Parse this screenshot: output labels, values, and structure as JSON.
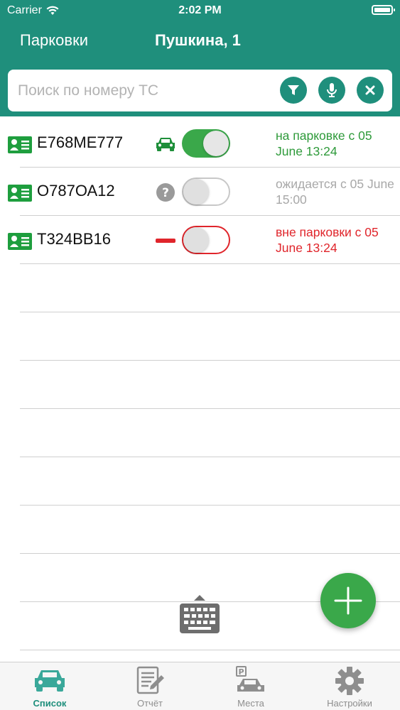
{
  "status_bar": {
    "carrier": "Carrier",
    "time": "2:02 PM"
  },
  "nav": {
    "back_label": "Парковки",
    "title": "Пушкина, 1"
  },
  "search": {
    "placeholder": "Поиск по номеру ТС",
    "value": ""
  },
  "vehicles": [
    {
      "plate": "Е768МЕ777",
      "state_icon": "car-icon",
      "toggle": "on",
      "status": "на парковке с 05 June 13:24",
      "status_color": "#2e9a3a"
    },
    {
      "plate": "О787ОА12",
      "state_icon": "question-icon",
      "toggle": "off",
      "status": "ожидается с 05 June 15:00",
      "status_color": "#a8a8a8"
    },
    {
      "plate": "Т324ВВ16",
      "state_icon": "minus-icon",
      "toggle": "off",
      "status": "вне парковки с 05 June 13:24",
      "status_color": "#e0252b"
    }
  ],
  "tabs": [
    {
      "label": "Список",
      "icon": "car-icon",
      "active": true
    },
    {
      "label": "Отчёт",
      "icon": "report-icon",
      "active": false
    },
    {
      "label": "Места",
      "icon": "parking-icon",
      "active": false
    },
    {
      "label": "Настройки",
      "icon": "gear-icon",
      "active": false
    }
  ],
  "colors": {
    "brand": "#1f8f7c",
    "green": "#3aa84a",
    "red": "#e0252b",
    "gray": "#a8a8a8"
  }
}
